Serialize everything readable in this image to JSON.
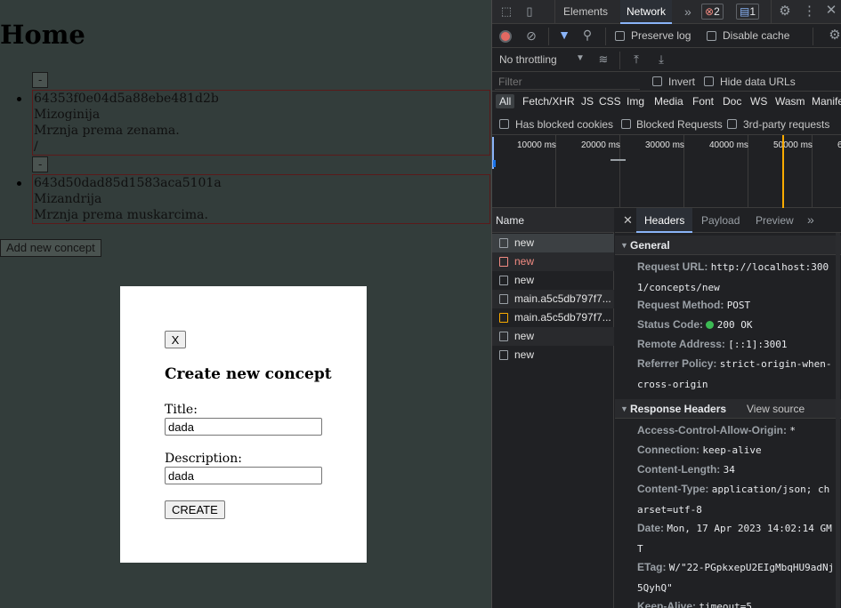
{
  "page": {
    "title": "Home",
    "remove_label": "-",
    "concepts": [
      {
        "id": "64353f0e04d5a88ebe481d2b",
        "title": "Mizoginija",
        "description": "Mrznja prema zenama.",
        "extra": "/"
      },
      {
        "id": "643d50dad85d1583aca5101a",
        "title": "Mizandrija",
        "description": "Mrznja prema muskarcima."
      }
    ],
    "add_button": "Add new concept"
  },
  "modal": {
    "close_label": "X",
    "title": "Create new concept",
    "title_label": "Title:",
    "title_value": "dada",
    "description_label": "Description:",
    "description_value": "dada",
    "create_label": "CREATE"
  },
  "devtools": {
    "tabs": [
      "Elements",
      "Network"
    ],
    "more_tabs": "»",
    "error_count": "2",
    "message_count": "1",
    "toolbar": {
      "preserve_log": "Preserve log",
      "disable_cache": "Disable cache",
      "throttling": "No throttling"
    },
    "filter": {
      "placeholder": "Filter",
      "invert": "Invert",
      "hide_data_urls": "Hide data URLs"
    },
    "type_filters": [
      "All",
      "Fetch/XHR",
      "JS",
      "CSS",
      "Img",
      "Media",
      "Font",
      "Doc",
      "WS",
      "Wasm",
      "Manifest"
    ],
    "options": {
      "blocked_cookies": "Has blocked cookies",
      "blocked_requests": "Blocked Requests",
      "third_party": "3rd-party requests"
    },
    "timeline": [
      "10000 ms",
      "20000 ms",
      "30000 ms",
      "40000 ms",
      "50000 ms",
      "6"
    ],
    "name_header": "Name",
    "requests": [
      {
        "name": "new",
        "error": false
      },
      {
        "name": "new",
        "error": true
      },
      {
        "name": "new",
        "error": false
      },
      {
        "name": "main.a5c5db797f7...",
        "error": false
      },
      {
        "name": "main.a5c5db797f7...",
        "error": false
      },
      {
        "name": "new",
        "error": false
      },
      {
        "name": "new",
        "error": false
      }
    ],
    "detail_tabs": [
      "Headers",
      "Payload",
      "Preview"
    ],
    "general": {
      "header": "General",
      "request_url_key": "Request URL:",
      "request_url_value_1": "http://localhost:300",
      "request_url_value_2": "1/concepts/new",
      "request_method_key": "Request Method:",
      "request_method_value": "POST",
      "status_code_key": "Status Code:",
      "status_code_value": "200 OK",
      "remote_address_key": "Remote Address:",
      "remote_address_value": "[::1]:3001",
      "referrer_policy_key": "Referrer Policy:",
      "referrer_policy_value_1": "strict-origin-when-",
      "referrer_policy_value_2": "cross-origin"
    },
    "response_headers": {
      "header": "Response Headers",
      "view_source": "View source",
      "acao_key": "Access-Control-Allow-Origin:",
      "acao_value": "*",
      "connection_key": "Connection:",
      "connection_value": "keep-alive",
      "content_length_key": "Content-Length:",
      "content_length_value": "34",
      "content_type_key": "Content-Type:",
      "content_type_value_1": "application/json; ch",
      "content_type_value_2": "arset=utf-8",
      "date_key": "Date:",
      "date_value_1": "Mon, 17 Apr 2023 14:02:14 GM",
      "date_value_2": "T",
      "etag_key": "ETag:",
      "etag_value_1": "W/\"22-PGpkxepU2EIgMbqHU9adNj",
      "etag_value_2": "5QyhQ\"",
      "keep_alive_key": "Keep-Alive:",
      "keep_alive_value": "timeout=5"
    },
    "colors": {
      "accent": "#8ab4f8",
      "error": "#f28b82",
      "status_ok": "#3cba54",
      "record": "#e46962"
    }
  }
}
